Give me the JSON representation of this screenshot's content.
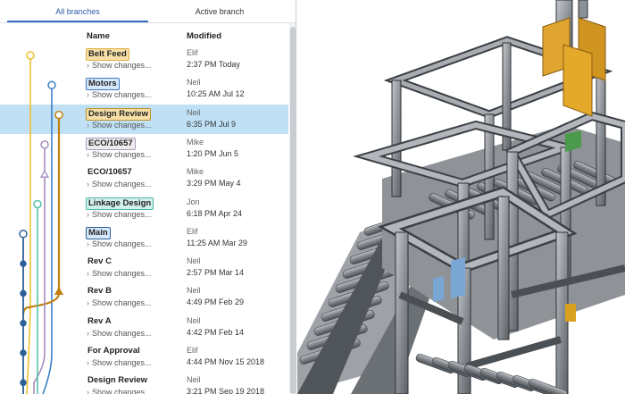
{
  "tabs": {
    "all_branches": "All branches",
    "active_branch": "Active branch"
  },
  "columns": {
    "name": "Name",
    "modified": "Modified"
  },
  "show_changes_label": "Show changes...",
  "rows": [
    {
      "name": "Belt Feed",
      "tag_color": "#f6e0a8",
      "tag_border": "#e0b040",
      "author": "Elif",
      "when": "2:37 PM Today"
    },
    {
      "name": "Motors",
      "tag_color": "#d6e8fb",
      "tag_border": "#3a78c8",
      "author": "Neil",
      "when": "10:25 AM Jul 12"
    },
    {
      "name": "Design Review",
      "tag_color": "#f6e0a8",
      "tag_border": "#c0902a",
      "author": "Neil",
      "when": "6:35 PM Jul 9",
      "selected": true
    },
    {
      "name": "ECO/10657",
      "tag_color": "#ececec",
      "tag_border": "#b09ac0",
      "author": "Mike",
      "when": "1:20 PM Jun 5"
    },
    {
      "name": "ECO/10657",
      "tag_color": "",
      "tag_border": "",
      "author": "Mike",
      "when": "3:29 PM May 4"
    },
    {
      "name": "Linkage Design",
      "tag_color": "#d2f1ea",
      "tag_border": "#49b8a0",
      "author": "Jon",
      "when": "6:18 PM Apr 24"
    },
    {
      "name": "Main",
      "tag_color": "#d6e8fb",
      "tag_border": "#2d5f99",
      "author": "Elif",
      "when": "11:25 AM Mar 29"
    },
    {
      "name": "Rev C",
      "tag_color": "",
      "tag_border": "",
      "author": "Neil",
      "when": "2:57 PM Mar 14"
    },
    {
      "name": "Rev B",
      "tag_color": "",
      "tag_border": "",
      "author": "Neil",
      "when": "4:49 PM Feb 29"
    },
    {
      "name": "Rev A",
      "tag_color": "",
      "tag_border": "",
      "author": "Neil",
      "when": "4:42 PM Feb 14"
    },
    {
      "name": "For Approval",
      "tag_color": "",
      "tag_border": "",
      "author": "Elif",
      "when": "4:44 PM Nov 15 2018"
    },
    {
      "name": "Design Review",
      "tag_color": "",
      "tag_border": "",
      "author": "Neil",
      "when": "3:21 PM Sep 19 2018"
    }
  ],
  "graph_colors": {
    "yellow": "#f0c030",
    "blue": "#3d7fc8",
    "dark_orange": "#c08010",
    "purple": "#a88cc0",
    "teal": "#54c1a8",
    "navy": "#2d5f99"
  }
}
